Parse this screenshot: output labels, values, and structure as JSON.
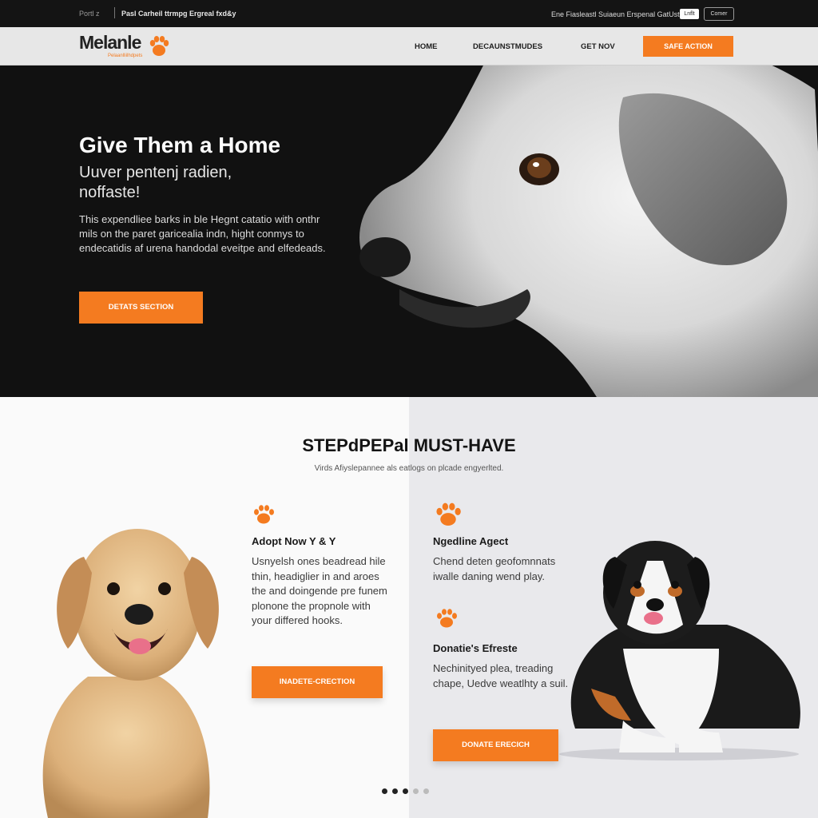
{
  "topbar": {
    "crumb": "Portl z",
    "tagline": "Pasl Carheil ttrmpg Ergreal fxd&y",
    "right_text": "Ene Fiasleastl Suiaeun Erspenal GatUstp",
    "button_a": "Lnflt",
    "button_b": "Comer"
  },
  "nav": {
    "logo_name": "Melanle",
    "logo_tag": "Pelaanlliilhdpets",
    "links": [
      "HOME",
      "DECAUNSTMUDES",
      "GET NOV"
    ],
    "cta_label": "SAFE ACTION"
  },
  "hero": {
    "title": "Give Them a Home",
    "subtitle": "Uuver pentenj radien, noffaste!",
    "body": "This expendliee barks in ble Hegnt catatio with onthr mils on the paret garicealia indn, hight conmys to endecatidis af urena handodal eveitpe and elfedeads.",
    "button": "DETATS SECTION"
  },
  "section": {
    "title": "STEPdPEPal MUST-HAVE",
    "subtitle": "Virds Afiyslepannee als eatlogs on plcade engyerlted."
  },
  "features": [
    {
      "title": "Adopt Now Y & Y",
      "body": "Usnyelsh ones beadread hile thin, headiglier in and aroes the and doingende pre funem plonone the propnole with your differed hooks.",
      "button": "INADETE-CRECTION"
    },
    {
      "title": "Ngedline Agect",
      "body": "Chend deten geofomnnats iwalle daning wend play."
    },
    {
      "title": "Donatie's Efreste",
      "body": "Nechinityed plea, treading chape, Uedve weatlhty a suil.",
      "button": "DONATE ERECICH"
    }
  ],
  "carousel": {
    "count": 5,
    "active": 2
  },
  "colors": {
    "accent": "#f47b20",
    "dark": "#111111",
    "panel": "#e9e9ec"
  }
}
